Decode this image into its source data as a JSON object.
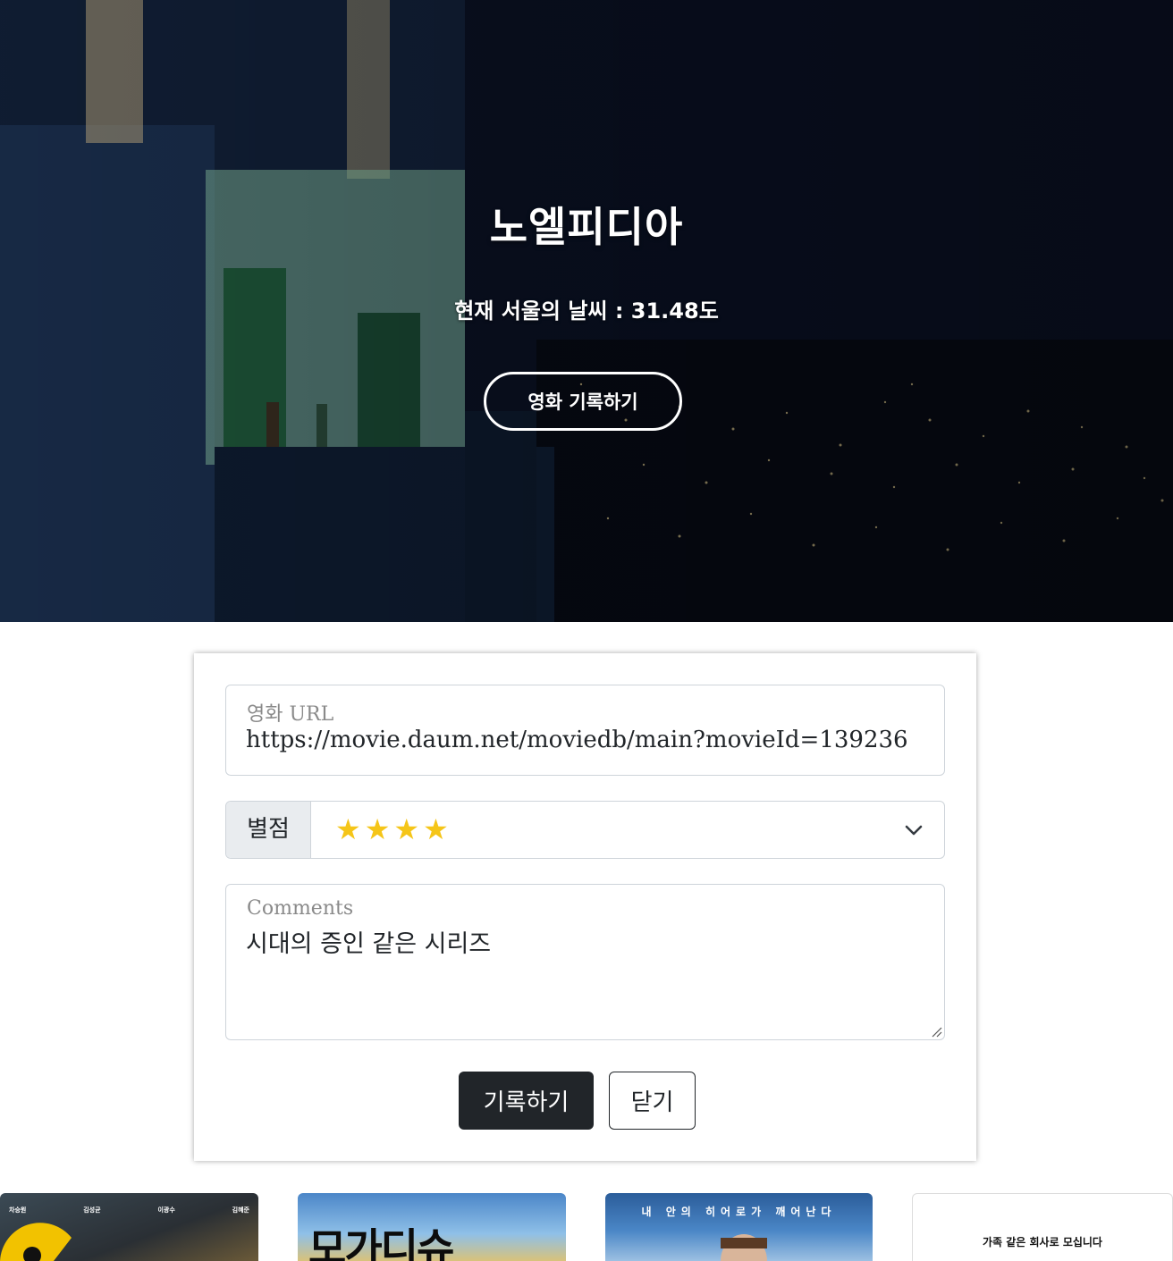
{
  "hero": {
    "title": "노엘피디아",
    "weather_text": "현재 서울의 날씨 : 31.48도",
    "record_button": "영화 기록하기"
  },
  "form": {
    "url_label": "영화 URL",
    "url_value": "https://movie.daum.net/moviedb/main?movieId=139236",
    "rating_label": "별점",
    "rating_display": "★★★★",
    "rating_stars": 4,
    "comments_label": "Comments",
    "comments_value": "시대의 증인 같은 시리즈",
    "submit_button": "기록하기",
    "close_button": "닫기"
  },
  "posters": [
    {
      "cast": [
        "차승원",
        "김성균",
        "이광수",
        "김혜준"
      ]
    },
    {
      "title": "모가디슈"
    },
    {
      "tagline": "내 안의 히어로가 깨어난다"
    },
    {
      "text": "가족 같은 회사로 모십니다"
    }
  ],
  "colors": {
    "star": "#f5c518",
    "primary_button": "#212529",
    "input_group_bg": "#e9ecef",
    "border": "#ced4da"
  }
}
